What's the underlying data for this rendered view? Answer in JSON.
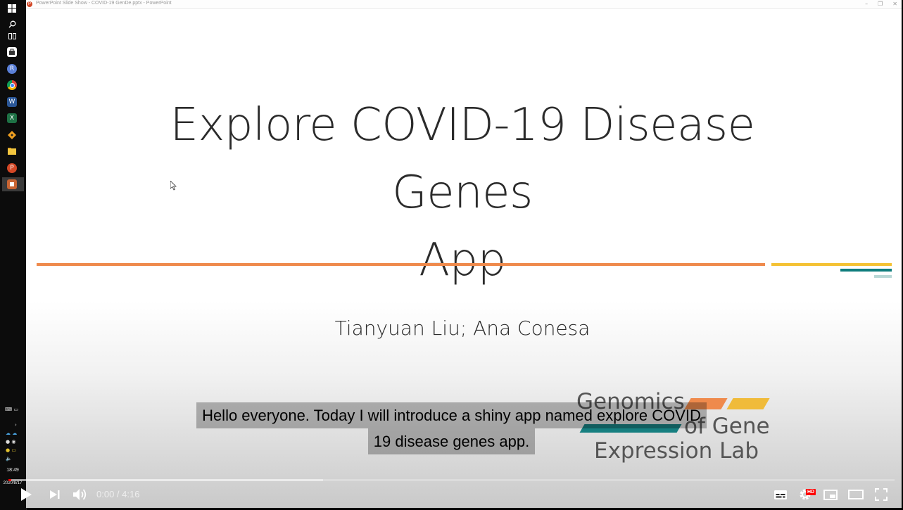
{
  "window": {
    "title": "PowerPoint Slide Show - COVID-19 GenDe.pptx - PowerPoint"
  },
  "slide": {
    "title_line1": "Explore COVID-19 Disease Genes",
    "title_line2": "App",
    "authors": "Tianyuan Liu; Ana Conesa",
    "lab_logo": {
      "word1": "Genomics",
      "word2": "of Gene",
      "word3": "Expression Lab"
    },
    "colors": {
      "orange": "#ef8a4c",
      "yellow": "#f4c234",
      "teal": "#0f7d7d"
    }
  },
  "taskbar": {
    "time": "18:49",
    "date": "2020/8/17",
    "icons": [
      "windows-icon",
      "search-icon",
      "task-view-icon",
      "store-icon",
      "r-icon",
      "chrome-icon",
      "word-icon",
      "excel-icon",
      "git-icon",
      "file-explorer-icon",
      "powerpoint-icon",
      "slideshow-icon"
    ]
  },
  "captions": {
    "line1": "Hello everyone. Today I will introduce a shiny app named explore COVID",
    "line2": "19 disease genes app."
  },
  "player": {
    "time_current": "0:00",
    "time_separator": " / ",
    "time_total": "4:16",
    "quality_badge": "HD",
    "progress_played_fraction": 0.0,
    "progress_buffered_fraction": 0.355
  }
}
